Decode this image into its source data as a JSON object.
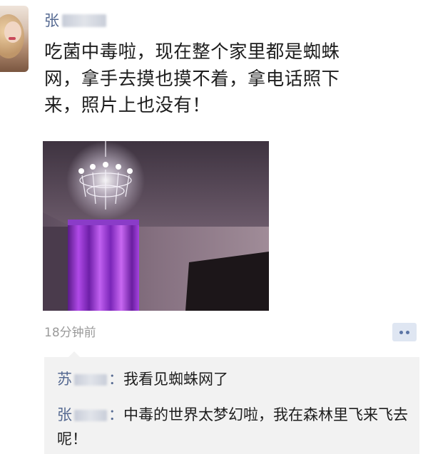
{
  "post": {
    "author_visible": "张",
    "text": "吃菌中毒啦，现在整个家里都是蜘蛛\n网，拿手去摸也摸不着，拿电话照下\n来，照片上也没有！",
    "time": "18分钟前"
  },
  "comments": [
    {
      "author_visible": "苏",
      "sep": "：",
      "text": "我看见蜘蛛网了"
    },
    {
      "author_visible": "张",
      "sep": "：",
      "text": "中毒的世界太梦幻啦，我在森林里飞来飞去呢！"
    }
  ],
  "icons": {
    "comment_button": "comment-dots-icon"
  },
  "colors": {
    "name": "#566a92",
    "text": "#1d1d1d",
    "time": "#9a9a9a",
    "comment_bg": "#f2f2f2"
  }
}
